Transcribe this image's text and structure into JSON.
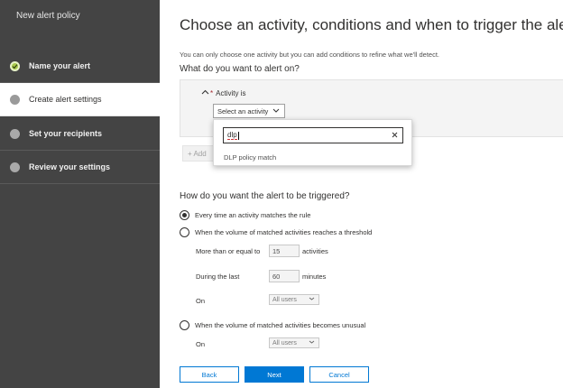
{
  "sidebar": {
    "title": "New alert policy",
    "steps": [
      {
        "label": "Name your alert"
      },
      {
        "label": "Create alert settings"
      },
      {
        "label": "Set your recipients"
      },
      {
        "label": "Review your settings"
      }
    ]
  },
  "main": {
    "title": "Choose an activity, conditions and when to trigger the alert",
    "subtitle": "You can only choose one activity but you can add conditions to refine what we'll detect.",
    "alert_on_heading": "What do you want to alert on?",
    "activity": {
      "required_mark": "*",
      "label": "Activity is",
      "select_label": "Select an activity"
    },
    "add_condition_label": "+ Add",
    "dropdown": {
      "search_value": "dlp",
      "option": "DLP policy match"
    },
    "trigger_heading": "How do you want the alert to be triggered?",
    "trigger": {
      "option1": "Every time an activity matches the rule",
      "option2": "When the volume of matched activities reaches a threshold",
      "threshold_label": "More than or equal to",
      "threshold_value": "15",
      "threshold_unit": "activities",
      "during_label": "During the last",
      "during_value": "60",
      "during_unit": "minutes",
      "on_label": "On",
      "on_value": "All users",
      "option3": "When the volume of matched activities becomes unusual",
      "on2_label": "On",
      "on2_value": "All users"
    },
    "buttons": {
      "back": "Back",
      "next": "Next",
      "cancel": "Cancel"
    }
  },
  "colors": {
    "sidebar_bg": "#444444",
    "step_done": "#a6c84a",
    "accent": "#0078d4"
  }
}
